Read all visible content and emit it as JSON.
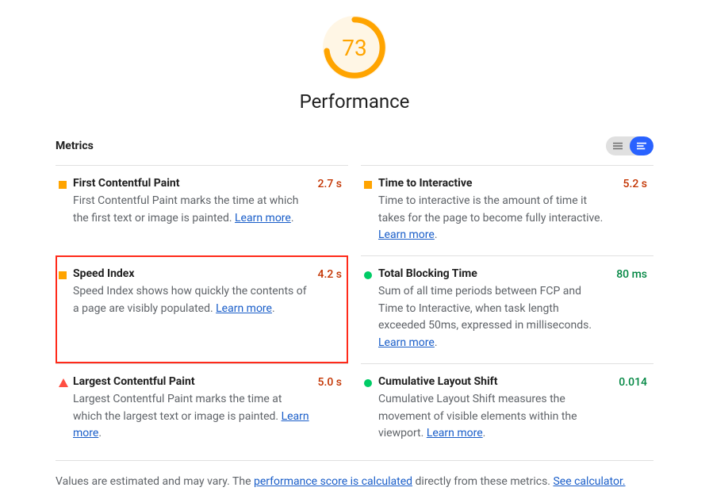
{
  "score": 73,
  "title": "Performance",
  "metrics_label": "Metrics",
  "learn_more": "Learn more",
  "metrics": {
    "fcp": {
      "title": "First Contentful Paint",
      "value": "2.7 s",
      "desc": "First Contentful Paint marks the time at which the first text or image is painted. "
    },
    "tti": {
      "title": "Time to Interactive",
      "value": "5.2 s",
      "desc": "Time to interactive is the amount of time it takes for the page to become fully interactive. "
    },
    "si": {
      "title": "Speed Index",
      "value": "4.2 s",
      "desc": "Speed Index shows how quickly the contents of a page are visibly populated. "
    },
    "tbt": {
      "title": "Total Blocking Time",
      "value": "80 ms",
      "desc": "Sum of all time periods between FCP and Time to Interactive, when task length exceeded 50ms, expressed in milliseconds. "
    },
    "lcp": {
      "title": "Largest Contentful Paint",
      "value": "5.0 s",
      "desc": "Largest Contentful Paint marks the time at which the largest text or image is painted. "
    },
    "cls": {
      "title": "Cumulative Layout Shift",
      "value": "0.014",
      "desc": "Cumulative Layout Shift measures the movement of visible elements within the viewport. "
    }
  },
  "footer": {
    "prefix": "Values are estimated and may vary. The ",
    "link1": "performance score is calculated",
    "mid": " directly from these metrics. ",
    "link2": "See calculator."
  }
}
